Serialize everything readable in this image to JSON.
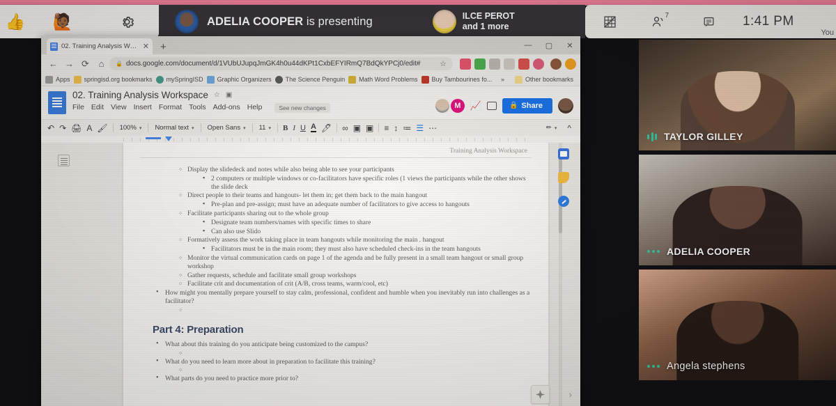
{
  "meet": {
    "left_tray": [
      {
        "name": "thumbs-up-reaction",
        "glyph": "👍"
      },
      {
        "name": "raise-hand-reaction",
        "glyph": "🙋🏾"
      },
      {
        "name": "settings-gear",
        "glyph": "⚙"
      }
    ],
    "presenting_name": "ADELIA COOPER",
    "presenting_suffix": " is presenting",
    "speaker_name": "ILCE PEROT",
    "speaker_more": "and 1 more",
    "right_icons": [
      {
        "name": "grid-layout-icon",
        "glyph": "▦"
      },
      {
        "name": "people-icon",
        "glyph": "👥",
        "badge": "7"
      },
      {
        "name": "chat-icon",
        "glyph": "🗨"
      }
    ],
    "time": "1:41 PM",
    "you_label": "You"
  },
  "chrome": {
    "tab_title": "02. Training Analysis Workspace",
    "tab_close": "✕",
    "new_tab": "+",
    "window_controls": [
      "—",
      "▢",
      "✕"
    ],
    "nav": [
      "←",
      "→",
      "⟳",
      "⌂"
    ],
    "url": "docs.google.com/document/d/1VUbUJupqJmGK4h0u44dKPt1CxbEFYIRmQ7BdQkYPCj0/edit#",
    "lock_icon": "🔒",
    "star_icon": "☆",
    "bookmarks": [
      {
        "label": "Apps",
        "color": "#9e9e9e"
      },
      {
        "label": "springisd.org bookmarks",
        "color": "#f2c14e"
      },
      {
        "label": "mySpringISD",
        "color": "#4a9a8a"
      },
      {
        "label": "Graphic Organizers",
        "color": "#6fa8dc"
      },
      {
        "label": "The Science Penguin",
        "color": "#5b5b5b"
      },
      {
        "label": "Math Word Problems",
        "color": "#d4b23a"
      },
      {
        "label": "Buy Tambourines fo...",
        "color": "#c0392b"
      }
    ],
    "bookmarks_overflow": "»",
    "other_bookmarks": "Other bookmarks"
  },
  "docs": {
    "doc_title": "02. Training Analysis Workspace",
    "star_icon": "☆",
    "move_icon": "▣",
    "menu": [
      "File",
      "Edit",
      "View",
      "Insert",
      "Format",
      "Tools",
      "Add-ons",
      "Help"
    ],
    "see_changes": "See new changes",
    "share_label": "Share",
    "toolbar": {
      "undo": "↶",
      "redo": "↷",
      "print": "🖨",
      "spell": "A",
      "paint": "🖌",
      "zoom": "100%",
      "style": "Normal text",
      "font": "Open Sans",
      "size": "11",
      "bold": "B",
      "italic": "I",
      "underline": "U",
      "text_color": "A",
      "highlight": "🖊",
      "link": "∞",
      "comment": "▣",
      "image": "▣",
      "align": "≡",
      "line_spacing": "↕",
      "numbered_list": "≔",
      "bulleted_list": "☰",
      "more": "⋯",
      "edit_mode": "✏",
      "collapse": "^"
    },
    "header_text": "Training  Analysis Workspace",
    "body": [
      {
        "level": 2,
        "text": "Display the slidedeck and notes while also being able to see your participants"
      },
      {
        "level": 3,
        "text": "2 computers or multiple windows or co-facilitators have specific roles (1 views the participants while the other shows the slide deck"
      },
      {
        "level": 2,
        "text": "Direct people to their teams and hangouts- let them in; get them back to the main hangout"
      },
      {
        "level": 3,
        "text": "Pre-plan and pre-assign; must have an adequate number of facilitators to give access to hangouts"
      },
      {
        "level": 2,
        "text": "Facilitate participants sharing out to the whole group"
      },
      {
        "level": 3,
        "text": "Designate team numbers/names with specific times to share"
      },
      {
        "level": 3,
        "text": "Can also use Slido"
      },
      {
        "level": 2,
        "text": "Formatively assess the work taking place in team hangouts while monitoring the main . hangout"
      },
      {
        "level": 3,
        "text": "Facilitators must be in the main room; they must also have scheduled check-ins in the team hangouts"
      },
      {
        "level": 2,
        "text": "Monitor the virtual communication cards on page 1 of the agenda and be fully present in a small team hangout or small group workshop"
      },
      {
        "level": 2,
        "text": "Gather requests, schedule and facilitate small group workshops"
      },
      {
        "level": 2,
        "text": "Facilitate crit and documentation of crit (A/B, cross teams, warm/cool, etc)"
      },
      {
        "level": 1,
        "text": "How might you mentally prepare yourself to stay calm, professional, confident and humble when you inevitably run into challenges as a facilitator?"
      },
      {
        "level": 2,
        "text": ""
      }
    ],
    "part_heading": "Part 4: Preparation",
    "part_body": [
      {
        "level": 1,
        "text": "What about this training do you anticipate being customized to the campus?"
      },
      {
        "level": 2,
        "text": ""
      },
      {
        "level": 1,
        "text": "What do you need to learn more about in preparation to facilitate this training?"
      },
      {
        "level": 2,
        "text": ""
      },
      {
        "level": 1,
        "text": "What parts do you need to practice more prior to?"
      }
    ],
    "side_icons": [
      {
        "name": "google-calendar-icon"
      },
      {
        "name": "google-keep-icon"
      },
      {
        "name": "google-tasks-icon"
      }
    ],
    "explore_icon": "explore-icon",
    "collapse_chevron": "›"
  },
  "tiles": [
    {
      "name": "TAYLOR GILLEY",
      "indicator": "bars",
      "style": "upper"
    },
    {
      "name": "ADELIA COOPER",
      "indicator": "dots",
      "style": "upper"
    },
    {
      "name": "Angela stephens",
      "indicator": "dots",
      "style": "lower"
    }
  ],
  "colors": {
    "accent_blue": "#1a73e8",
    "meet_dark": "#38353a",
    "bezel_pink": "#ef7f99",
    "mic_green": "#34c9a3",
    "heading_navy": "#3d4a6b"
  }
}
